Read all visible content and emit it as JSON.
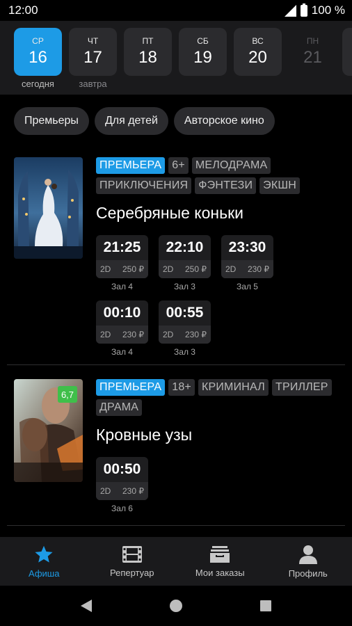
{
  "status": {
    "time": "12:00",
    "battery": "100 %"
  },
  "dates": [
    {
      "weekday": "СР",
      "day": "16",
      "sub": "сегодня",
      "state": "active"
    },
    {
      "weekday": "ЧТ",
      "day": "17",
      "sub": "завтра",
      "state": "normal"
    },
    {
      "weekday": "ПТ",
      "day": "18",
      "sub": "",
      "state": "normal"
    },
    {
      "weekday": "СБ",
      "day": "19",
      "sub": "",
      "state": "normal"
    },
    {
      "weekday": "ВС",
      "day": "20",
      "sub": "",
      "state": "normal"
    },
    {
      "weekday": "ПН",
      "day": "21",
      "sub": "",
      "state": "dim"
    }
  ],
  "filters": [
    "Премьеры",
    "Для детей",
    "Авторское кино"
  ],
  "movies": [
    {
      "title": "Серебряные коньки",
      "tags": [
        "ПРЕМЬЕРА",
        "6+",
        "МЕЛОДРАМА",
        "ПРИКЛЮЧЕНИЯ",
        "ФЭНТЕЗИ",
        "ЭКШН"
      ],
      "rating": "",
      "shows": [
        {
          "time": "21:25",
          "format": "2D",
          "price": "250 ₽",
          "hall": "Зал 4"
        },
        {
          "time": "22:10",
          "format": "2D",
          "price": "250 ₽",
          "hall": "Зал 3"
        },
        {
          "time": "23:30",
          "format": "2D",
          "price": "230 ₽",
          "hall": "Зал 5"
        },
        {
          "time": "00:10",
          "format": "2D",
          "price": "230 ₽",
          "hall": "Зал 4"
        },
        {
          "time": "00:55",
          "format": "2D",
          "price": "230 ₽",
          "hall": "Зал 3"
        }
      ]
    },
    {
      "title": "Кровные узы",
      "tags": [
        "ПРЕМЬЕРА",
        "18+",
        "КРИМИНАЛ",
        "ТРИЛЛЕР",
        "ДРАМА"
      ],
      "rating": "6,7",
      "shows": [
        {
          "time": "00:50",
          "format": "2D",
          "price": "230 ₽",
          "hall": "Зал 6"
        }
      ]
    }
  ],
  "nav": [
    {
      "label": "Афиша",
      "icon": "star-icon",
      "active": true
    },
    {
      "label": "Репертуар",
      "icon": "film-icon",
      "active": false
    },
    {
      "label": "Мои заказы",
      "icon": "orders-icon",
      "active": false
    },
    {
      "label": "Профиль",
      "icon": "profile-icon",
      "active": false
    }
  ],
  "colors": {
    "accent": "#1d9be6",
    "rating": "#3fbf4a"
  }
}
